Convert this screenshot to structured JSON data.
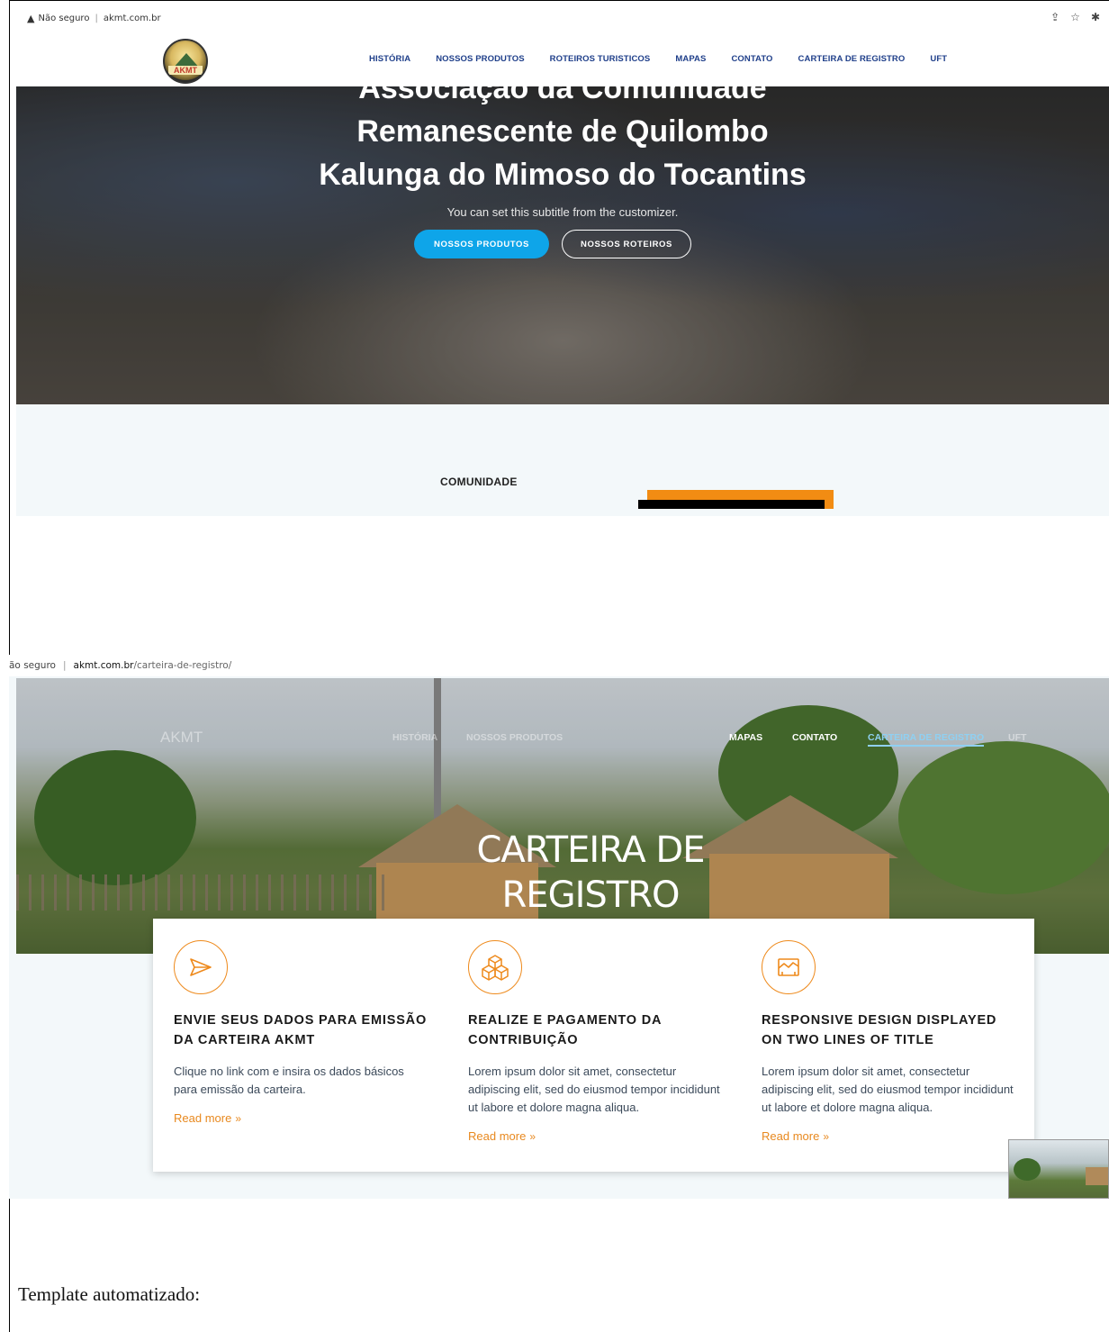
{
  "browser1": {
    "security_warning": "Não seguro",
    "url": "akmt.com.br"
  },
  "site": {
    "logo_text": "AKMT",
    "nav": [
      "HISTÓRIA",
      "NOSSOS PRODUTOS",
      "ROTEIROS TURISTICOS",
      "MAPAS",
      "CONTATO",
      "CARTEIRA DE REGISTRO",
      "UFT"
    ]
  },
  "hero1": {
    "title_line1": "Associação da Comunidade",
    "title_line2": "Remanescente de Quilombo",
    "title_line3": "Kalunga do Mimoso do Tocantins",
    "subtitle": "You can set this subtitle from the customizer.",
    "primary_button": "NOSSOS PRODUTOS",
    "secondary_button": "NOSSOS ROTEIROS"
  },
  "section": {
    "label": "COMUNIDADE"
  },
  "browser2": {
    "security_warning": "ão seguro",
    "domain": "akmt.com.br",
    "path": "/carteira-de-registro/"
  },
  "page2": {
    "brand": "AKMT",
    "nav_faint": [
      "HISTÓRIA",
      "NOSSOS PRODUTOS"
    ],
    "nav_solid": [
      "MAPAS",
      "CONTATO"
    ],
    "nav_active": "CARTEIRA DE REGISTRO",
    "nav_last": "UFT",
    "title_line1": "CARTEIRA DE",
    "title_line2": "REGISTRO",
    "features": [
      {
        "icon": "paper-plane-icon",
        "title": "ENVIE SEUS DADOS PARA EMISSÃO DA CARTEIRA AKMT",
        "description": "Clique no link  com e insira os dados básicos para emissão da carteira.",
        "link": "Read more"
      },
      {
        "icon": "cubes-icon",
        "title": "REALIZE E PAGAMENTO DA CONTRIBUIÇÃO",
        "description": "Lorem ipsum dolor sit amet, consectetur adipiscing elit, sed do eiusmod tempor incididunt ut labore et dolore magna aliqua.",
        "link": "Read more"
      },
      {
        "icon": "responsive-screen-icon",
        "title": "RESPONSIVE DESIGN DISPLAYED ON TWO LINES OF TITLE",
        "description": "Lorem ipsum dolor sit amet, consectetur adipiscing elit, sed do eiusmod tempor incididunt ut labore et dolore magna aliqua.",
        "link": "Read more"
      }
    ]
  },
  "document": {
    "caption": "Template automatizado:"
  },
  "colors": {
    "accent_orange": "#e8891f",
    "button_blue": "#0ea5e9",
    "nav_blue": "#1f3f8a"
  }
}
